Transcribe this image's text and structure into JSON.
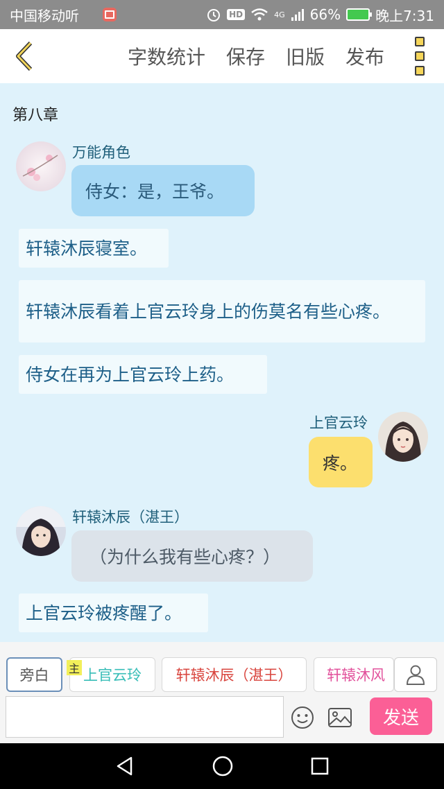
{
  "status_bar": {
    "carrier": "中国移动听",
    "network": "4G",
    "battery": "66%",
    "time": "晚上7:31",
    "hd": "HD"
  },
  "toolbar": {
    "actions": [
      "字数统计",
      "保存",
      "旧版",
      "发布"
    ]
  },
  "content": {
    "chapter": "第八章",
    "messages": [
      {
        "name": "万能角色",
        "text": "侍女：是，王爷。"
      },
      {
        "narration": "轩辕沐辰寝室。"
      },
      {
        "narration": "轩辕沐辰看着上官云玲身上的伤莫名有些心疼。"
      },
      {
        "narration": "侍女在再为上官云玲上药。"
      },
      {
        "name": "上官云玲",
        "text": "疼。"
      },
      {
        "name": "轩辕沐辰（湛王）",
        "text": "（为什么我有些心疼？）"
      },
      {
        "narration": "上官云玲被疼醒了。"
      }
    ]
  },
  "input_area": {
    "chips": [
      "旁白",
      "上官云玲",
      "轩辕沐辰（湛王）",
      "轩辕沐风"
    ],
    "main_badge": "主",
    "input_value": "",
    "send_label": "发送"
  },
  "colors": {
    "background": "#dff2fb",
    "blue_bubble": "#a8d9f5",
    "yellow_bubble": "#fcdf6e",
    "grey_bubble": "#dce3ea",
    "send": "#fb5f96",
    "chip_cyan": "#37bdb7",
    "chip_red": "#d9463f",
    "chip_pink": "#e2529c"
  }
}
